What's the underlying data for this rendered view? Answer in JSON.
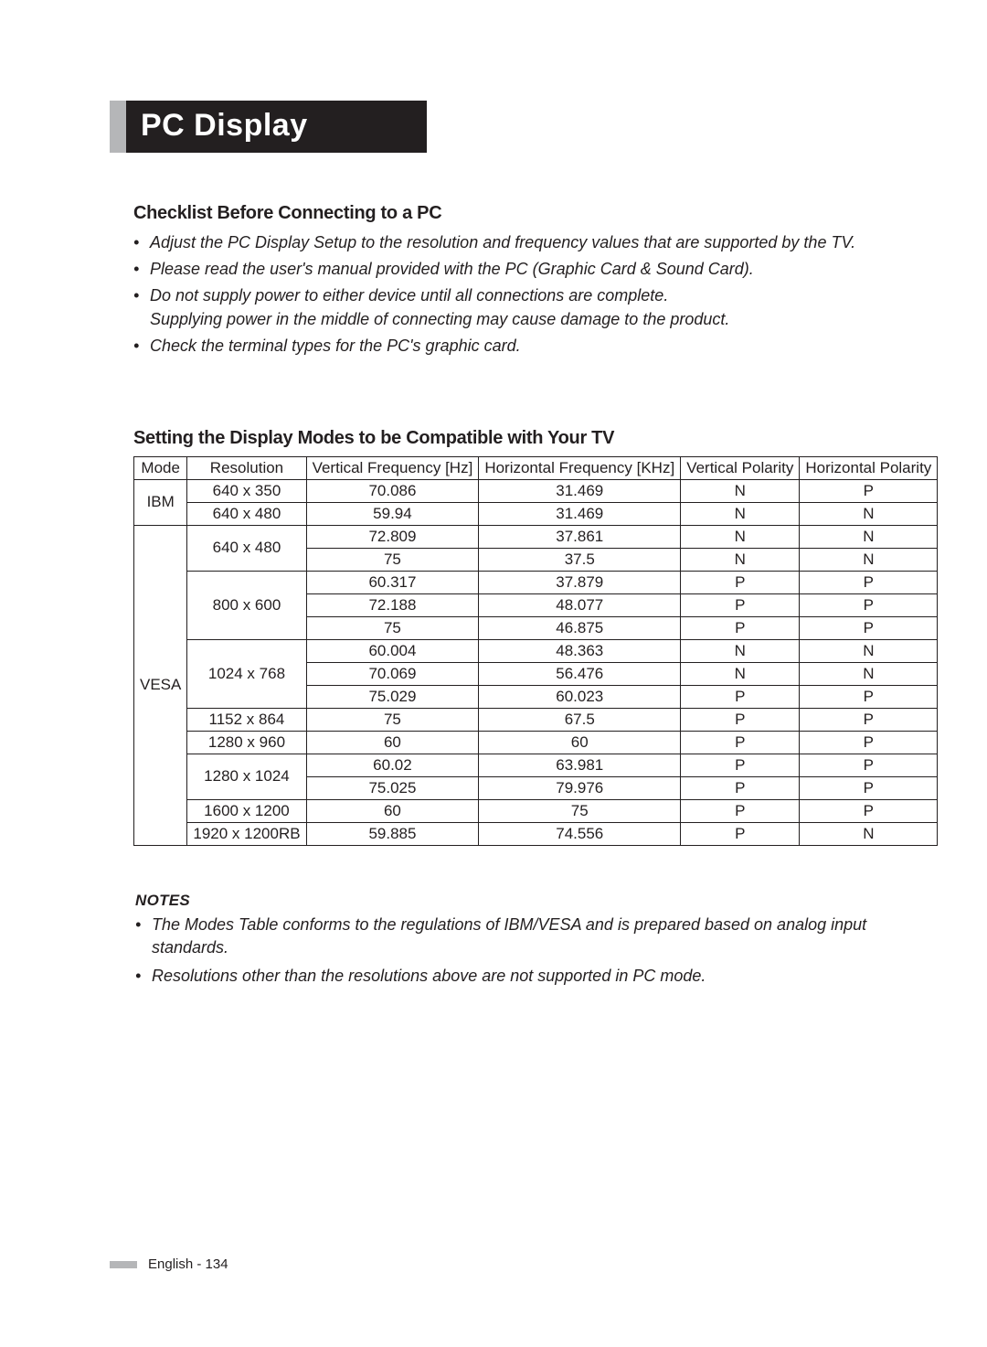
{
  "page_title": "PC Display",
  "checklist": {
    "heading": "Checklist Before Connecting to a PC",
    "items": [
      "Adjust the PC Display Setup to the resolution and frequency values that are supported by the TV.",
      "Please read the user's manual provided with the PC (Graphic Card & Sound Card).",
      "Do not supply power to either device until all connections are complete.\nSupplying power in the middle of connecting may cause damage to the product.",
      "Check the terminal types for the PC's graphic card."
    ]
  },
  "modes_table": {
    "heading": "Setting the Display Modes to be Compatible with Your TV",
    "columns": [
      "Mode",
      "Resolution",
      "Vertical Frequency [Hz]",
      "Horizontal Frequency [KHz]",
      "Vertical Polarity",
      "Horizontal Polarity"
    ],
    "groups": [
      {
        "mode": "IBM",
        "rows": [
          {
            "res": "640 x 350",
            "vfreq": "70.086",
            "hfreq": "31.469",
            "vpol": "N",
            "hpol": "P"
          },
          {
            "res": "640 x 480",
            "vfreq": "59.94",
            "hfreq": "31.469",
            "vpol": "N",
            "hpol": "N"
          }
        ]
      },
      {
        "mode": "VESA",
        "rows": [
          {
            "res": "640 x 480",
            "vfreq": "72.809",
            "hfreq": "37.861",
            "vpol": "N",
            "hpol": "N"
          },
          {
            "res": "",
            "vfreq": "75",
            "hfreq": "37.5",
            "vpol": "N",
            "hpol": "N"
          },
          {
            "res": "800 x 600",
            "vfreq": "60.317",
            "hfreq": "37.879",
            "vpol": "P",
            "hpol": "P"
          },
          {
            "res": "",
            "vfreq": "72.188",
            "hfreq": "48.077",
            "vpol": "P",
            "hpol": "P"
          },
          {
            "res": "",
            "vfreq": "75",
            "hfreq": "46.875",
            "vpol": "P",
            "hpol": "P"
          },
          {
            "res": "1024 x 768",
            "vfreq": "60.004",
            "hfreq": "48.363",
            "vpol": "N",
            "hpol": "N"
          },
          {
            "res": "",
            "vfreq": "70.069",
            "hfreq": "56.476",
            "vpol": "N",
            "hpol": "N"
          },
          {
            "res": "",
            "vfreq": "75.029",
            "hfreq": "60.023",
            "vpol": "P",
            "hpol": "P"
          },
          {
            "res": "1152 x 864",
            "vfreq": "75",
            "hfreq": "67.5",
            "vpol": "P",
            "hpol": "P"
          },
          {
            "res": "1280 x 960",
            "vfreq": "60",
            "hfreq": "60",
            "vpol": "P",
            "hpol": "P"
          },
          {
            "res": "1280 x 1024",
            "vfreq": "60.02",
            "hfreq": "63.981",
            "vpol": "P",
            "hpol": "P"
          },
          {
            "res": "",
            "vfreq": "75.025",
            "hfreq": "79.976",
            "vpol": "P",
            "hpol": "P"
          },
          {
            "res": "1600 x 1200",
            "vfreq": "60",
            "hfreq": "75",
            "vpol": "P",
            "hpol": "P"
          },
          {
            "res": "1920 x 1200RB",
            "vfreq": "59.885",
            "hfreq": "74.556",
            "vpol": "P",
            "hpol": "N"
          }
        ]
      }
    ]
  },
  "notes": {
    "heading": "NOTES",
    "items": [
      "The Modes Table conforms to the regulations of IBM/VESA and is prepared based on analog input standards.",
      "Resolutions other than the resolutions above are not supported in PC mode."
    ]
  },
  "footer": {
    "text": "English - 134"
  },
  "chart_data": {
    "type": "table",
    "title": "Setting the Display Modes to be Compatible with Your TV",
    "columns": [
      "Mode",
      "Resolution",
      "Vertical Frequency [Hz]",
      "Horizontal Frequency [KHz]",
      "Vertical Polarity",
      "Horizontal Polarity"
    ],
    "rows": [
      [
        "IBM",
        "640 x 350",
        70.086,
        31.469,
        "N",
        "P"
      ],
      [
        "IBM",
        "640 x 480",
        59.94,
        31.469,
        "N",
        "N"
      ],
      [
        "VESA",
        "640 x 480",
        72.809,
        37.861,
        "N",
        "N"
      ],
      [
        "VESA",
        "640 x 480",
        75,
        37.5,
        "N",
        "N"
      ],
      [
        "VESA",
        "800 x 600",
        60.317,
        37.879,
        "P",
        "P"
      ],
      [
        "VESA",
        "800 x 600",
        72.188,
        48.077,
        "P",
        "P"
      ],
      [
        "VESA",
        "800 x 600",
        75,
        46.875,
        "P",
        "P"
      ],
      [
        "VESA",
        "1024 x 768",
        60.004,
        48.363,
        "N",
        "N"
      ],
      [
        "VESA",
        "1024 x 768",
        70.069,
        56.476,
        "N",
        "N"
      ],
      [
        "VESA",
        "1024 x 768",
        75.029,
        60.023,
        "P",
        "P"
      ],
      [
        "VESA",
        "1152 x 864",
        75,
        67.5,
        "P",
        "P"
      ],
      [
        "VESA",
        "1280 x 960",
        60,
        60,
        "P",
        "P"
      ],
      [
        "VESA",
        "1280 x 1024",
        60.02,
        63.981,
        "P",
        "P"
      ],
      [
        "VESA",
        "1280 x 1024",
        75.025,
        79.976,
        "P",
        "P"
      ],
      [
        "VESA",
        "1600 x 1200",
        60,
        75,
        "P",
        "P"
      ],
      [
        "VESA",
        "1920 x 1200RB",
        59.885,
        74.556,
        "P",
        "N"
      ]
    ]
  }
}
